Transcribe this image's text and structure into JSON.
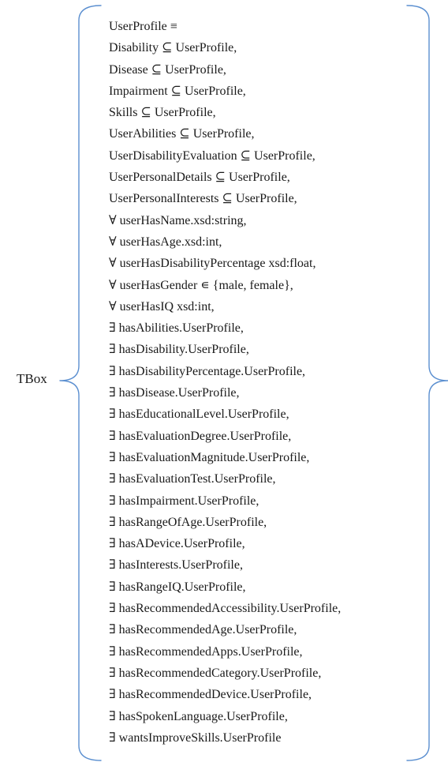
{
  "tbox": {
    "label": "TBox",
    "bracket_color": "#5b8fd0",
    "axioms": [
      "UserProfile ≡",
      "Disability ⊆ UserProfile,",
      "Disease ⊆ UserProfile,",
      "Impairment ⊆ UserProfile,",
      "Skills ⊆ UserProfile,",
      "UserAbilities ⊆ UserProfile,",
      "UserDisabilityEvaluation ⊆ UserProfile,",
      "UserPersonalDetails ⊆ UserProfile,",
      "UserPersonalInterests ⊆ UserProfile,",
      "∀ userHasName.xsd:string,",
      "∀ userHasAge.xsd:int,",
      "∀ userHasDisabilityPercentage xsd:float,",
      "∀ userHasGender ∊ {male, female},",
      "∀ userHasIQ xsd:int,",
      "∃ hasAbilities.UserProfile,",
      "∃ hasDisability.UserProfile,",
      "∃ hasDisabilityPercentage.UserProfile,",
      "∃ hasDisease.UserProfile,",
      "∃ hasEducationalLevel.UserProfile,",
      "∃ hasEvaluationDegree.UserProfile,",
      "∃ hasEvaluationMagnitude.UserProfile,",
      "∃ hasEvaluationTest.UserProfile,",
      "∃ hasImpairment.UserProfile,",
      "∃ hasRangeOfAge.UserProfile,",
      "∃ hasADevice.UserProfile,",
      "∃ hasInterests.UserProfile,",
      "∃ hasRangeIQ.UserProfile,",
      "∃ hasRecommendedAccessibility.UserProfile,",
      "∃ hasRecommendedAge.UserProfile,",
      "∃ hasRecommendedApps.UserProfile,",
      "∃ hasRecommendedCategory.UserProfile,",
      "∃ hasRecommendedDevice.UserProfile,",
      "∃ hasSpokenLanguage.UserProfile,",
      "∃ wantsImproveSkills.UserProfile"
    ]
  }
}
